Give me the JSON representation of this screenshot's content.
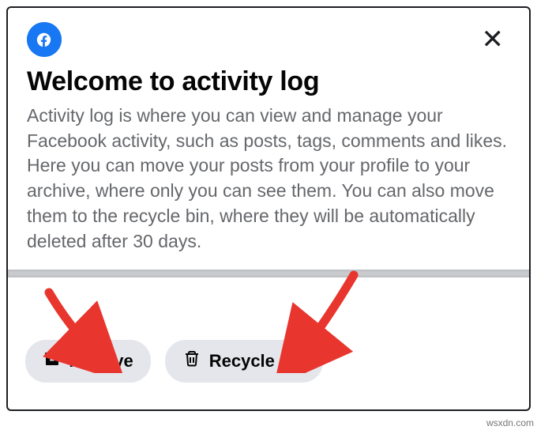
{
  "header": {
    "logo_name": "facebook-logo"
  },
  "title": "Welcome to activity log",
  "description": "Activity log is where you can view and manage your Facebook activity, such as posts, tags, comments and likes. Here you can move your posts from your profile to your archive, where only you can see them. You can also move them to the recycle bin, where they will be automatically deleted after 30 days.",
  "buttons": {
    "archive": "Archive",
    "recycle": "Recycle bin"
  },
  "watermark": "wsxdn.com"
}
